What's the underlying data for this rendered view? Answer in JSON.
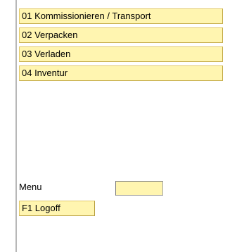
{
  "menu_items": [
    {
      "label": "01 Kommissionieren / Transport"
    },
    {
      "label": "02 Verpacken"
    },
    {
      "label": "03 Verladen"
    },
    {
      "label": "04 Inventur"
    }
  ],
  "menu_field": {
    "label": "Menu",
    "value": ""
  },
  "logoff": {
    "label": "F1 Logoff"
  },
  "colors": {
    "button_bg": "#fff5b0",
    "background": "#ffffff"
  }
}
